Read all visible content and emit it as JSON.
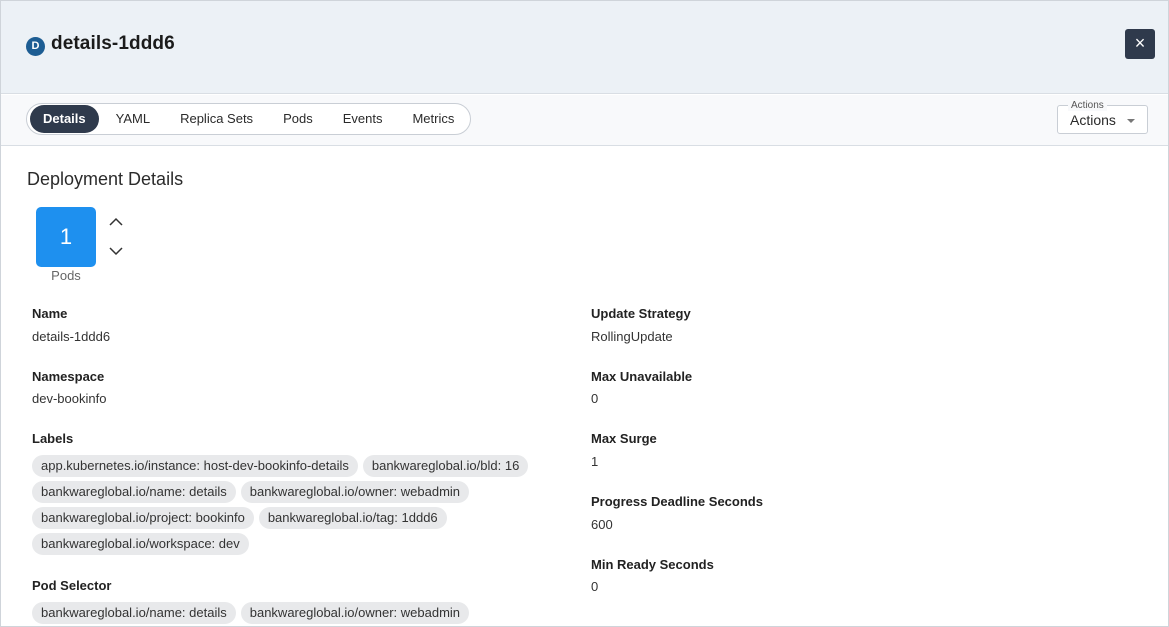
{
  "header": {
    "kind_badge": "D",
    "title": "details-1ddd6",
    "close_icon": "×"
  },
  "tabs": [
    {
      "label": "Details",
      "active": true
    },
    {
      "label": "YAML",
      "active": false
    },
    {
      "label": "Replica Sets",
      "active": false
    },
    {
      "label": "Pods",
      "active": false
    },
    {
      "label": "Events",
      "active": false
    },
    {
      "label": "Metrics",
      "active": false
    }
  ],
  "actions": {
    "legend": "Actions",
    "value": "Actions"
  },
  "section_title": "Deployment Details",
  "pods": {
    "count": "1",
    "label": "Pods"
  },
  "left": {
    "name": {
      "label": "Name",
      "value": "details-1ddd6"
    },
    "namespace": {
      "label": "Namespace",
      "value": "dev-bookinfo"
    },
    "labels": {
      "label": "Labels",
      "items": [
        "app.kubernetes.io/instance: host-dev-bookinfo-details",
        "bankwareglobal.io/bld: 16",
        "bankwareglobal.io/name: details",
        "bankwareglobal.io/owner: webadmin",
        "bankwareglobal.io/project: bookinfo",
        "bankwareglobal.io/tag: 1ddd6",
        "bankwareglobal.io/workspace: dev"
      ]
    },
    "pod_selector": {
      "label": "Pod Selector",
      "items": [
        "bankwareglobal.io/name: details",
        "bankwareglobal.io/owner: webadmin"
      ]
    }
  },
  "right": {
    "update_strategy": {
      "label": "Update Strategy",
      "value": "RollingUpdate"
    },
    "max_unavailable": {
      "label": "Max Unavailable",
      "value": "0"
    },
    "max_surge": {
      "label": "Max Surge",
      "value": "1"
    },
    "progress_deadline": {
      "label": "Progress Deadline Seconds",
      "value": "600"
    },
    "min_ready": {
      "label": "Min Ready Seconds",
      "value": "0"
    }
  },
  "colors": {
    "header_bg": "#ecf1f6",
    "active_tab": "#2f3a4c",
    "pod_box": "#1e90ef",
    "badge": "#1d5d93",
    "chip_bg": "#e8e9eb"
  }
}
